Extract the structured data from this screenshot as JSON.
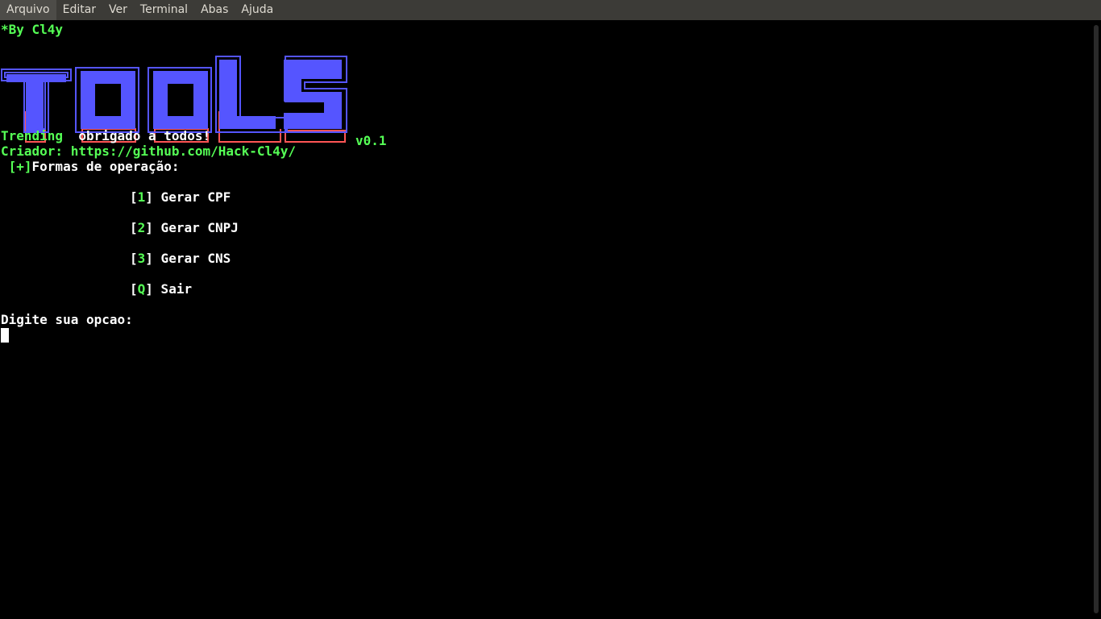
{
  "menubar": {
    "items": [
      "Arquivo",
      "Editar",
      "Ver",
      "Terminal",
      "Abas",
      "Ajuda"
    ]
  },
  "terminal": {
    "by_line": "*By Cl4y",
    "banner_icon": "tools-ascii-logo",
    "banner_colors": {
      "main": "#5555ff",
      "shadow": "#ff5555",
      "outline": "#5555ff"
    },
    "version": "v0.1",
    "trending_label": "Trending",
    "trending_text": "  obrigado a todos!",
    "criador_line": "Criador: https://github.com/Hack-Cl4y/",
    "formas_prefix": " [+]",
    "formas_text": "Formas de operação:",
    "options": [
      {
        "key": "1",
        "label": " Gerar CPF"
      },
      {
        "key": "2",
        "label": " Gerar CNPJ"
      },
      {
        "key": "3",
        "label": " Gerar CNS"
      },
      {
        "key": "Q",
        "label": " Sair"
      }
    ],
    "prompt": "Digite sua opcao:"
  }
}
